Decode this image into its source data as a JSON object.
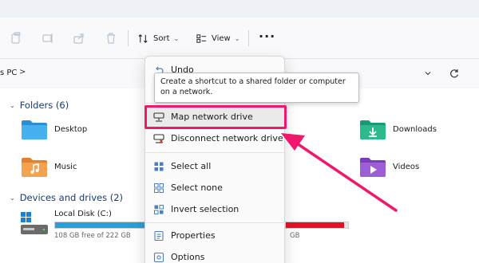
{
  "toolbar": {
    "sort_label": "Sort",
    "view_label": "View",
    "more_label": "···"
  },
  "address": {
    "path": "s PC",
    "separator": ">"
  },
  "sections": {
    "folders": "Folders (6)",
    "devices": "Devices and drives (2)"
  },
  "folders": {
    "desktop": "Desktop",
    "downloads": "Downloads",
    "music": "Music",
    "videos": "Videos"
  },
  "drives": {
    "c_label": "Local Disk (C:)",
    "c_free": "108 GB free of 222 GB",
    "c_used_fraction": 0.51,
    "d_free": "GB",
    "d_used_fraction": 0.93
  },
  "menu": {
    "undo": "Undo",
    "map_drive": "Map network drive",
    "disconnect_drive": "Disconnect network drive",
    "select_all": "Select all",
    "select_none": "Select none",
    "invert_selection": "Invert selection",
    "properties": "Properties",
    "options": "Options"
  },
  "tooltip": {
    "text": "Create a shortcut to a shared folder or computer on a network."
  },
  "colors": {
    "accent": "#0067c0",
    "highlight": "#f0176d",
    "drive_c_fill": "#26a0da",
    "drive_d_fill": "#e81123"
  }
}
